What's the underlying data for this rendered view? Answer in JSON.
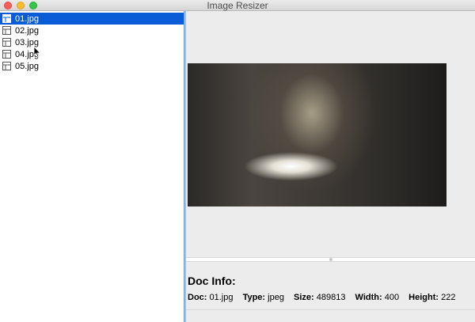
{
  "window": {
    "title": "Image Resizer"
  },
  "sidebar": {
    "items": [
      {
        "label": "01.jpg",
        "icon": "image-file-icon",
        "selected": true
      },
      {
        "label": "02.jpg",
        "icon": "image-file-icon",
        "selected": false
      },
      {
        "label": "03.jpg",
        "icon": "image-file-icon",
        "selected": false
      },
      {
        "label": "04.jpg",
        "icon": "image-file-icon",
        "selected": false
      },
      {
        "label": "05.jpg",
        "icon": "image-file-icon",
        "selected": false
      }
    ]
  },
  "doc_info": {
    "heading": "Doc Info:",
    "doc_label": "Doc:",
    "doc_value": "01.jpg",
    "type_label": "Type:",
    "type_value": "jpeg",
    "size_label": "Size:",
    "size_value": "489813",
    "width_label": "Width:",
    "width_value": "400",
    "height_label": "Height:",
    "height_value": "222"
  },
  "colors": {
    "selection": "#0a5bd6",
    "splitter": "#9dc0e6"
  }
}
